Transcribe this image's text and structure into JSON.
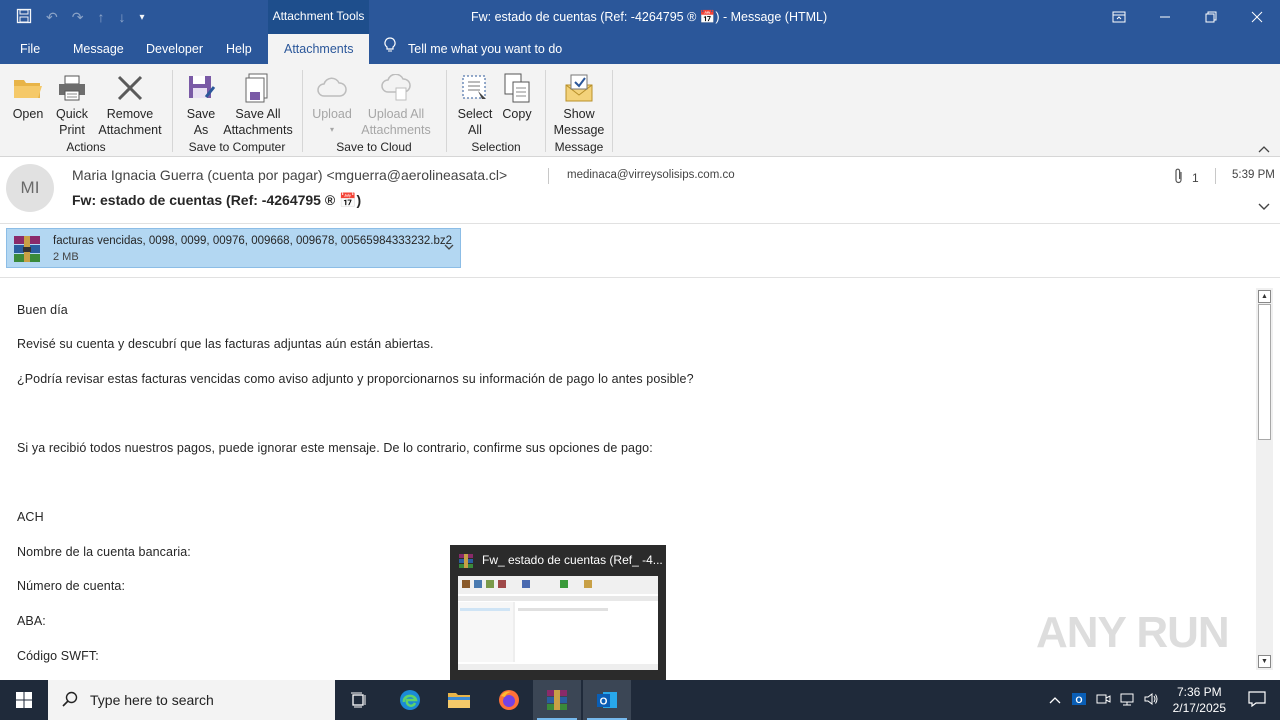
{
  "titlebar": {
    "context_tab": "Attachment Tools",
    "window_title": "Fw: estado de cuentas (Ref: -4264795 ® 📅)  -  Message (HTML)"
  },
  "tabs": {
    "file": "File",
    "message": "Message",
    "developer": "Developer",
    "help": "Help",
    "attachments": "Attachments",
    "tell_me": "Tell me what you want to do"
  },
  "ribbon": {
    "open": "Open",
    "quick_print": "Quick Print",
    "remove_attachment": "Remove Attachment",
    "group_actions": "Actions",
    "save_as": "Save As",
    "save_all_attachments": "Save All Attachments",
    "group_save_to_computer": "Save to Computer",
    "upload": "Upload",
    "upload_all_attachments": "Upload All Attachments",
    "group_save_to_cloud": "Save to Cloud",
    "select_all": "Select All",
    "copy": "Copy",
    "group_selection": "Selection",
    "show_message": "Show Message",
    "group_message": "Message"
  },
  "header": {
    "avatar_initials": "MI",
    "from": "Maria Ignacia Guerra (cuenta por pagar) <mguerra@aerolineasata.cl>",
    "to": "medinaca@virreysolisips.com.co",
    "subject": "Fw: estado de cuentas (Ref: -4264795 ® 📅)",
    "attachment_count": "1",
    "time": "5:39 PM"
  },
  "attachment": {
    "name": "facturas vencidas, 0098, 0099, 00976, 009668, 009678, 00565984333232.bz2",
    "size": "2 MB"
  },
  "body": {
    "greeting": "Buen día",
    "line1": "Revisé su cuenta y descubrí que las facturas adjuntas aún están abiertas.",
    "line2": "¿Podría revisar estas facturas vencidas como aviso adjunto y proporcionarnos su información de pago lo antes posible?",
    "line3": "Si ya recibió todos nuestros pagos, puede ignorar este mensaje. De lo contrario, confirme sus opciones de pago:",
    "ach": "ACH",
    "bank_account_name": "Nombre de la cuenta bancaria:",
    "account_number": "Número de cuenta:",
    "aba": "ABA:",
    "swift": "Código SWFT:"
  },
  "preview": {
    "title": "Fw_ estado de cuentas (Ref_ -4..."
  },
  "watermark": "ANY RUN",
  "taskbar": {
    "search_placeholder": "Type here to search",
    "time": "7:36 PM",
    "date": "2/17/2025"
  },
  "colors": {
    "accent": "#2b579a",
    "attachment_selected": "#b3d7f2",
    "taskbar": "#1f2a3a"
  }
}
